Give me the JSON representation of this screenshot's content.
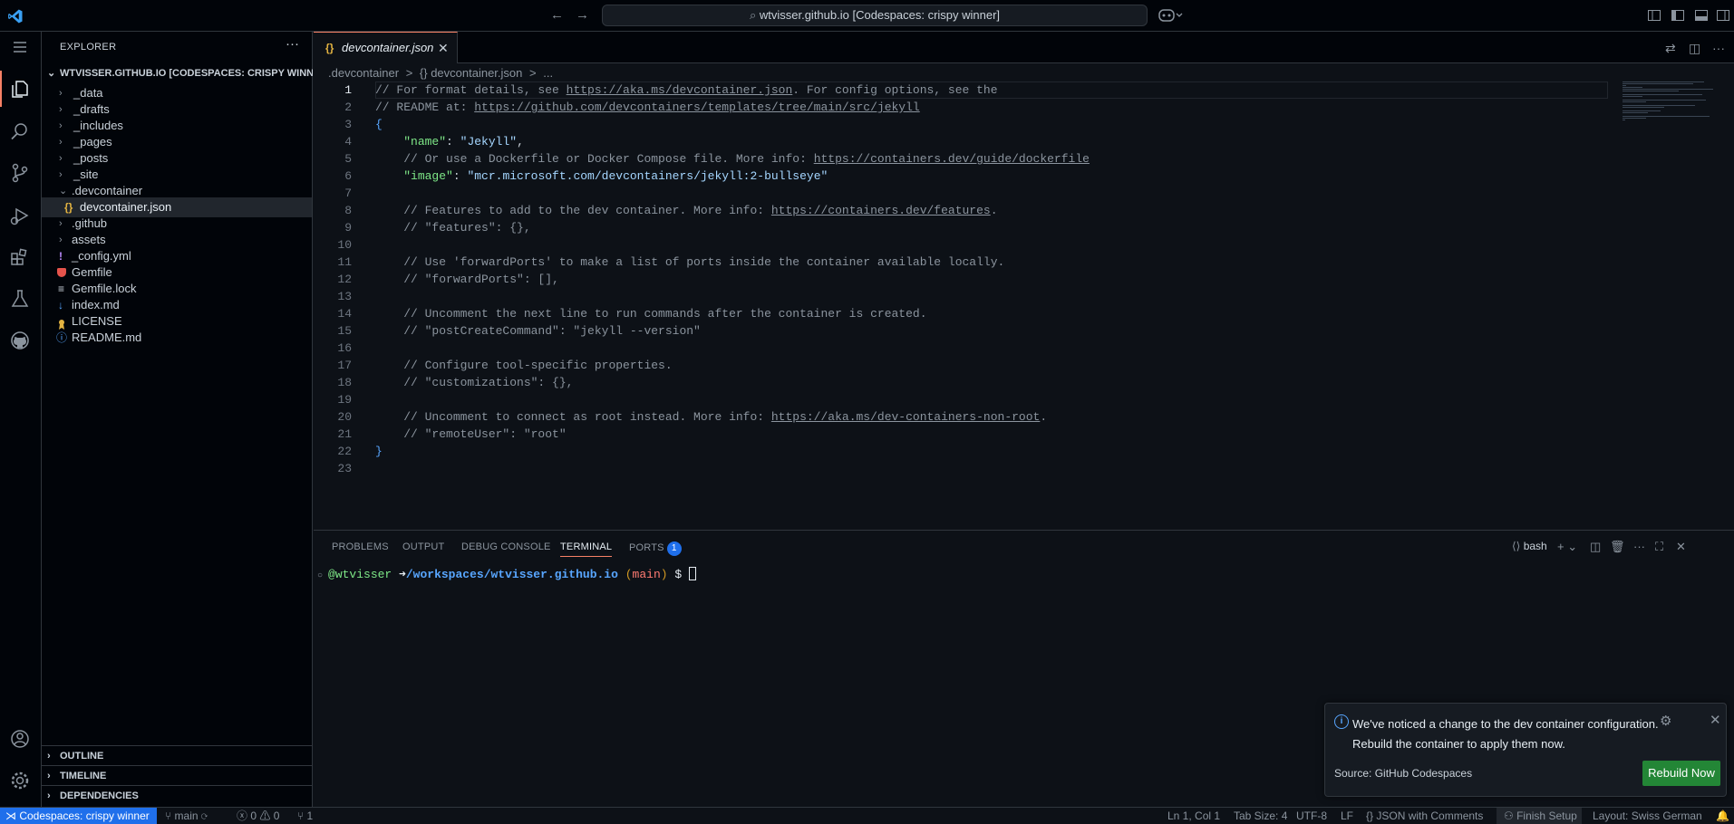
{
  "title_bar": {
    "search_text": "wtvisser.github.io [Codespaces: crispy winner]",
    "back_icon": "arrow-left-icon",
    "forward_icon": "arrow-right-icon",
    "copilot_icon": "copilot-icon"
  },
  "sidebar": {
    "header": "EXPLORER",
    "more": "···",
    "root_folder": "WTVISSER.GITHUB.IO [CODESPACES: CRISPY WINNER]",
    "tree": [
      {
        "label": "_data",
        "type": "folder",
        "expanded": false
      },
      {
        "label": "_drafts",
        "type": "folder",
        "expanded": false
      },
      {
        "label": "_includes",
        "type": "folder",
        "expanded": false
      },
      {
        "label": "_pages",
        "type": "folder",
        "expanded": false
      },
      {
        "label": "_posts",
        "type": "folder",
        "expanded": false
      },
      {
        "label": "_site",
        "type": "folder",
        "expanded": false
      },
      {
        "label": ".devcontainer",
        "type": "folder",
        "expanded": true
      },
      {
        "label": "devcontainer.json",
        "type": "file",
        "icon": "{}",
        "selected": true
      },
      {
        "label": ".github",
        "type": "folder",
        "expanded": false
      },
      {
        "label": "assets",
        "type": "folder",
        "expanded": false
      },
      {
        "label": "_config.yml",
        "type": "file",
        "icon": "!"
      },
      {
        "label": "Gemfile",
        "type": "file",
        "icon": "ruby"
      },
      {
        "label": "Gemfile.lock",
        "type": "file",
        "icon": "≡"
      },
      {
        "label": "index.md",
        "type": "file",
        "icon": "↓"
      },
      {
        "label": "LICENSE",
        "type": "file",
        "icon": "license"
      },
      {
        "label": "README.md",
        "type": "file",
        "icon": "ⓘ"
      }
    ],
    "sections": [
      "OUTLINE",
      "TIMELINE",
      "DEPENDENCIES"
    ]
  },
  "editor": {
    "tab_label": "devcontainer.json",
    "tab_icon": "{}",
    "breadcrumb": [
      ".devcontainer",
      ">",
      "{} devcontainer.json",
      ">",
      "..."
    ],
    "current_line": 1,
    "lines": [
      "// For format details, see https://aka.ms/devcontainer.json. For config options, see the",
      "// README at: https://github.com/devcontainers/templates/tree/main/src/jekyll",
      "{",
      "    \"name\": \"Jekyll\",",
      "    // Or use a Dockerfile or Docker Compose file. More info: https://containers.dev/guide/dockerfile",
      "    \"image\": \"mcr.microsoft.com/devcontainers/jekyll:2-bullseye\"",
      "",
      "    // Features to add to the dev container. More info: https://containers.dev/features.",
      "    // \"features\": {},",
      "",
      "    // Use 'forwardPorts' to make a list of ports inside the container available locally.",
      "    // \"forwardPorts\": [],",
      "",
      "    // Uncomment the next line to run commands after the container is created.",
      "    // \"postCreateCommand\": \"jekyll --version\"",
      "",
      "    // Configure tool-specific properties.",
      "    // \"customizations\": {},",
      "",
      "    // Uncomment to connect as root instead. More info: https://aka.ms/dev-containers-non-root.",
      "    // \"remoteUser\": \"root\"",
      "}",
      ""
    ]
  },
  "panel": {
    "tabs": [
      "PROBLEMS",
      "OUTPUT",
      "DEBUG CONSOLE",
      "TERMINAL",
      "PORTS"
    ],
    "active_tab": "TERMINAL",
    "ports_badge": "1",
    "shell": "bash",
    "terminal": {
      "user": "@wtvisser",
      "arrow": "➜",
      "path": "/workspaces/wtvisser.github.io",
      "branch_open": "(",
      "branch": "main",
      "branch_close": ")",
      "prompt": "$"
    }
  },
  "notification": {
    "message": "We've noticed a change to the dev container configuration. Rebuild the container to apply them now.",
    "source": "Source: GitHub Codespaces",
    "button": "Rebuild Now"
  },
  "status_bar": {
    "remote": "Codespaces: crispy winner",
    "branch": "main",
    "errors": "0",
    "warnings": "0",
    "ports": "1",
    "position": "Ln 1, Col 1",
    "tab_size": "Tab Size: 4",
    "encoding": "UTF-8",
    "eol": "LF",
    "language": "JSON with Comments",
    "finish_setup": "Finish Setup",
    "layout": "Layout: Swiss German"
  },
  "colors": {
    "background": "#0d1117",
    "accent": "#f78166",
    "remote": "#1f6feb",
    "button": "#238636"
  }
}
